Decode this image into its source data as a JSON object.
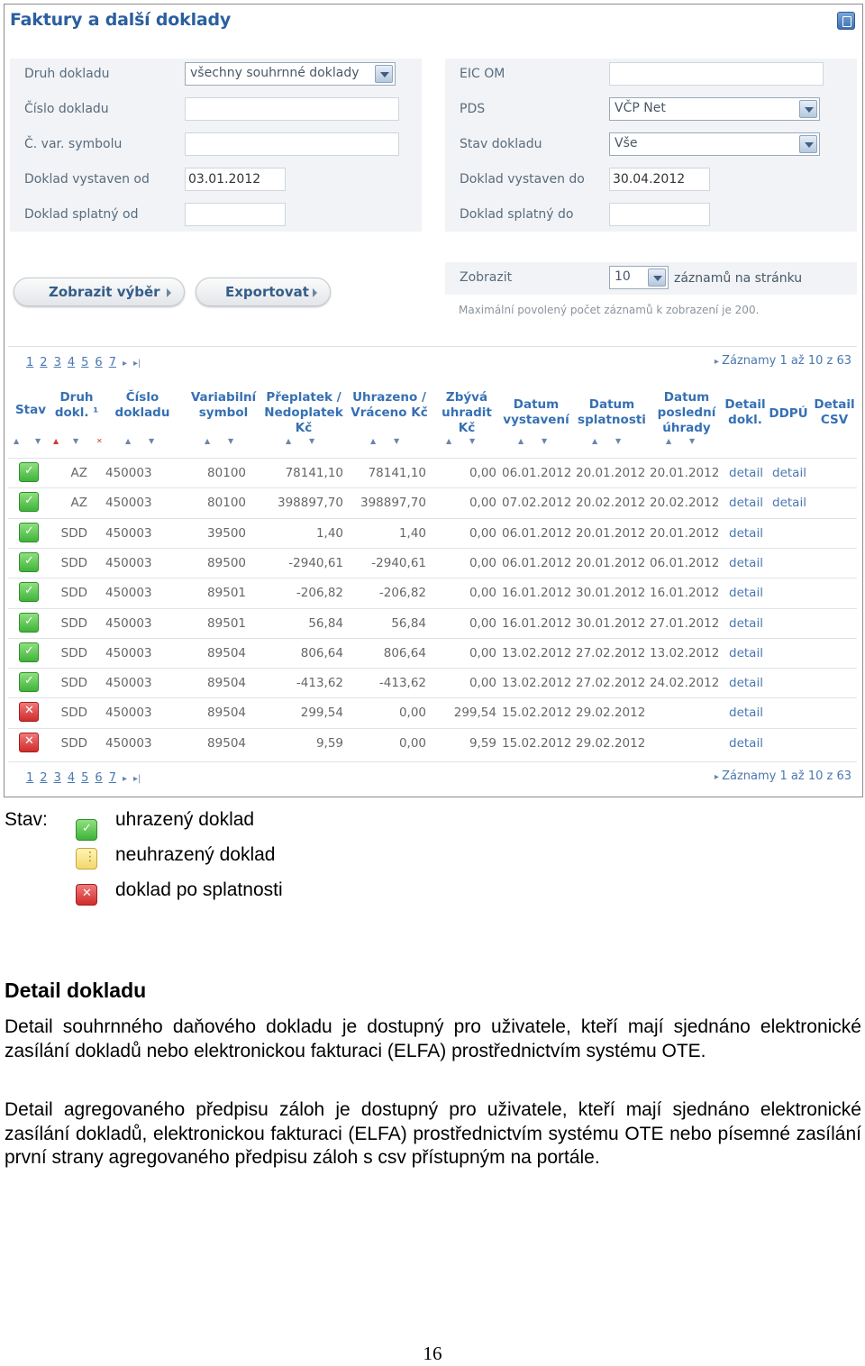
{
  "app": {
    "title": "Faktury a další doklady"
  },
  "filters_left": [
    {
      "label": "Druh dokladu",
      "type": "select",
      "value": "všechny souhrnné doklady"
    },
    {
      "label": "Číslo dokladu",
      "type": "input",
      "value": ""
    },
    {
      "label": "Č. var. symbolu",
      "type": "input",
      "value": ""
    },
    {
      "label": "Doklad vystaven od",
      "type": "input",
      "value": "03.01.2012"
    },
    {
      "label": "Doklad splatný od",
      "type": "input",
      "value": ""
    }
  ],
  "filters_right": [
    {
      "label": "EIC OM",
      "type": "input",
      "value": ""
    },
    {
      "label": "PDS",
      "type": "select",
      "value": "VČP Net"
    },
    {
      "label": "Stav dokladu",
      "type": "select",
      "value": "Vše"
    },
    {
      "label": "Doklad vystaven do",
      "type": "input",
      "value": "30.04.2012"
    },
    {
      "label": "Doklad splatný do",
      "type": "input",
      "value": ""
    }
  ],
  "buttons": {
    "show_selection": "Zobrazit výběr",
    "export": "Exportovat"
  },
  "paging": {
    "show_label": "Zobrazit",
    "per_page": "10",
    "per_page_suffix": "záznamů na stránku",
    "note": "Maximální povolený počet záznamů k zobrazení je 200.",
    "pages": [
      "1",
      "2",
      "3",
      "4",
      "5",
      "6",
      "7"
    ],
    "next": "▸",
    "last": "▸|",
    "records_info": "Záznamy 1 až 10 z 63"
  },
  "table": {
    "columns": [
      {
        "label": "Stav"
      },
      {
        "label": "Druh dokl. ¹"
      },
      {
        "label": "Číslo dokladu"
      },
      {
        "label": "Variabilní symbol"
      },
      {
        "label": "Přeplatek / Nedoplatek Kč"
      },
      {
        "label": "Uhrazeno / Vráceno Kč"
      },
      {
        "label": "Zbývá uhradit Kč"
      },
      {
        "label": "Datum vystavení"
      },
      {
        "label": "Datum splatnosti"
      },
      {
        "label": "Datum poslední úhrady"
      },
      {
        "label": "Detail dokl."
      },
      {
        "label": "DDPÚ"
      },
      {
        "label": "Detail CSV"
      }
    ],
    "rows": [
      {
        "status": "ok",
        "druh": "AZ",
        "cislo": "450003",
        "vs": "80100",
        "preplatek": "78141,10",
        "uhrazeno": "78141,10",
        "zbyva": "0,00",
        "vystaveni": "06.01.2012",
        "splatnost": "20.01.2012",
        "posledni": "20.01.2012",
        "detail": "detail",
        "ddpu": "detail",
        "csv": ""
      },
      {
        "status": "ok",
        "druh": "AZ",
        "cislo": "450003",
        "vs": "80100",
        "preplatek": "398897,70",
        "uhrazeno": "398897,70",
        "zbyva": "0,00",
        "vystaveni": "07.02.2012",
        "splatnost": "20.02.2012",
        "posledni": "20.02.2012",
        "detail": "detail",
        "ddpu": "detail",
        "csv": ""
      },
      {
        "status": "ok",
        "druh": "SDD",
        "cislo": "450003",
        "vs": "39500",
        "preplatek": "1,40",
        "uhrazeno": "1,40",
        "zbyva": "0,00",
        "vystaveni": "06.01.2012",
        "splatnost": "20.01.2012",
        "posledni": "20.01.2012",
        "detail": "detail",
        "ddpu": "",
        "csv": ""
      },
      {
        "status": "ok",
        "druh": "SDD",
        "cislo": "450003",
        "vs": "89500",
        "preplatek": "-2940,61",
        "uhrazeno": "-2940,61",
        "zbyva": "0,00",
        "vystaveni": "06.01.2012",
        "splatnost": "20.01.2012",
        "posledni": "06.01.2012",
        "detail": "detail",
        "ddpu": "",
        "csv": ""
      },
      {
        "status": "ok",
        "druh": "SDD",
        "cislo": "450003",
        "vs": "89501",
        "preplatek": "-206,82",
        "uhrazeno": "-206,82",
        "zbyva": "0,00",
        "vystaveni": "16.01.2012",
        "splatnost": "30.01.2012",
        "posledni": "16.01.2012",
        "detail": "detail",
        "ddpu": "",
        "csv": ""
      },
      {
        "status": "ok",
        "druh": "SDD",
        "cislo": "450003",
        "vs": "89501",
        "preplatek": "56,84",
        "uhrazeno": "56,84",
        "zbyva": "0,00",
        "vystaveni": "16.01.2012",
        "splatnost": "30.01.2012",
        "posledni": "27.01.2012",
        "detail": "detail",
        "ddpu": "",
        "csv": ""
      },
      {
        "status": "ok",
        "druh": "SDD",
        "cislo": "450003",
        "vs": "89504",
        "preplatek": "806,64",
        "uhrazeno": "806,64",
        "zbyva": "0,00",
        "vystaveni": "13.02.2012",
        "splatnost": "27.02.2012",
        "posledni": "13.02.2012",
        "detail": "detail",
        "ddpu": "",
        "csv": ""
      },
      {
        "status": "ok",
        "druh": "SDD",
        "cislo": "450003",
        "vs": "89504",
        "preplatek": "-413,62",
        "uhrazeno": "-413,62",
        "zbyva": "0,00",
        "vystaveni": "13.02.2012",
        "splatnost": "27.02.2012",
        "posledni": "24.02.2012",
        "detail": "detail",
        "ddpu": "",
        "csv": ""
      },
      {
        "status": "bad",
        "druh": "SDD",
        "cislo": "450003",
        "vs": "89504",
        "preplatek": "299,54",
        "uhrazeno": "0,00",
        "zbyva": "299,54",
        "vystaveni": "15.02.2012",
        "splatnost": "29.02.2012",
        "posledni": "",
        "detail": "detail",
        "ddpu": "",
        "csv": ""
      },
      {
        "status": "bad",
        "druh": "SDD",
        "cislo": "450003",
        "vs": "89504",
        "preplatek": "9,59",
        "uhrazeno": "0,00",
        "zbyva": "9,59",
        "vystaveni": "15.02.2012",
        "splatnost": "29.02.2012",
        "posledni": "",
        "detail": "detail",
        "ddpu": "",
        "csv": ""
      }
    ]
  },
  "legend": {
    "label": "Stav:",
    "items": [
      {
        "icon": "paid-icon",
        "text": "uhrazený doklad"
      },
      {
        "icon": "unpaid-icon",
        "text": "neuhrazený doklad"
      },
      {
        "icon": "overdue-icon",
        "text": "doklad po splatnosti"
      }
    ]
  },
  "section": {
    "heading": "Detail dokladu",
    "paragraphs": [
      "Detail souhrnného daňového dokladu je dostupný pro uživatele, kteří mají sjednáno elektronické zasílání dokladů nebo elektronickou fakturaci (ELFA) prostřednictvím systému OTE.",
      "Detail agregovaného předpisu záloh je dostupný pro uživatele, kteří mají sjednáno elektronické zasílání dokladů, elektronickou fakturaci (ELFA) prostřednictvím systému OTE nebo písemné zasílání první strany agregovaného předpisu záloh s csv přístupným na portále."
    ]
  },
  "page_number": "16",
  "colors": {
    "title": "#2b5f9e",
    "link": "#4a77b0",
    "header": "#3670b3",
    "ok": "#3fb33a",
    "overdue": "#d12c2c",
    "pending": "#f2d96a"
  }
}
